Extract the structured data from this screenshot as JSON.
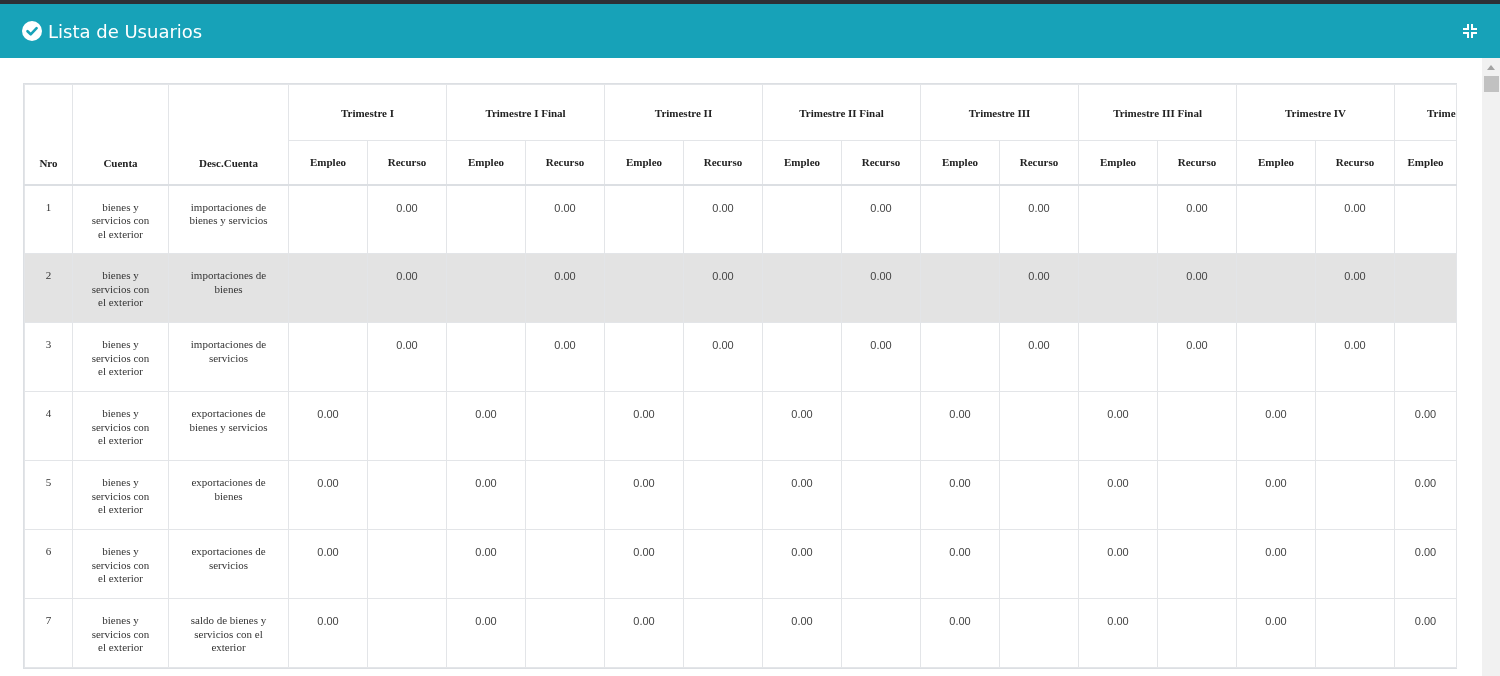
{
  "window": {
    "title": "Lista de Usuarios"
  },
  "table": {
    "columns": [
      {
        "label": "Nro"
      },
      {
        "label": "Cuenta"
      },
      {
        "label": "Desc.Cuenta"
      }
    ],
    "groups": [
      {
        "label": "Trimestre I",
        "subcolumns": [
          "Empleo",
          "Recurso"
        ]
      },
      {
        "label": "Trimestre I Final",
        "subcolumns": [
          "Empleo",
          "Recurso"
        ]
      },
      {
        "label": "Trimestre II",
        "subcolumns": [
          "Empleo",
          "Recurso"
        ]
      },
      {
        "label": "Trimestre II Final",
        "subcolumns": [
          "Empleo",
          "Recurso"
        ]
      },
      {
        "label": "Trimestre III",
        "subcolumns": [
          "Empleo",
          "Recurso"
        ]
      },
      {
        "label": "Trimestre III Final",
        "subcolumns": [
          "Empleo",
          "Recurso"
        ]
      },
      {
        "label": "Trimestre IV",
        "subcolumns": [
          "Empleo",
          "Recurso"
        ]
      },
      {
        "label": "Trime",
        "subcolumns": [
          "Empleo"
        ]
      }
    ],
    "rows": [
      {
        "nro": "1",
        "cuenta": "bienes y servicios con el exterior",
        "desc": "importaciones de bienes y servicios",
        "selected": false,
        "quarters": [
          {
            "recurso": "0.00"
          },
          {
            "recurso": "0.00"
          },
          {
            "recurso": "0.00"
          },
          {
            "recurso": "0.00"
          },
          {
            "recurso": "0.00"
          },
          {
            "recurso": "0.00"
          },
          {
            "recurso": "0.00"
          }
        ]
      },
      {
        "nro": "2",
        "cuenta": "bienes y servicios con el exterior",
        "desc": "importaciones de bienes",
        "selected": true,
        "quarters": [
          {
            "recurso": "0.00"
          },
          {
            "recurso": "0.00"
          },
          {
            "recurso": "0.00"
          },
          {
            "recurso": "0.00"
          },
          {
            "recurso": "0.00"
          },
          {
            "recurso": "0.00"
          },
          {
            "recurso": "0.00"
          }
        ]
      },
      {
        "nro": "3",
        "cuenta": "bienes y servicios con el exterior",
        "desc": "importaciones de servicios",
        "selected": false,
        "quarters": [
          {
            "recurso": "0.00"
          },
          {
            "recurso": "0.00"
          },
          {
            "recurso": "0.00"
          },
          {
            "recurso": "0.00"
          },
          {
            "recurso": "0.00"
          },
          {
            "recurso": "0.00"
          },
          {
            "recurso": "0.00"
          }
        ]
      },
      {
        "nro": "4",
        "cuenta": "bienes y servicios con el exterior",
        "desc": "exportaciones de bienes y servicios",
        "selected": false,
        "quarters": [
          {
            "empleo": "0.00"
          },
          {
            "empleo": "0.00"
          },
          {
            "empleo": "0.00"
          },
          {
            "empleo": "0.00"
          },
          {
            "empleo": "0.00"
          },
          {
            "empleo": "0.00"
          },
          {
            "empleo": "0.00"
          },
          {
            "empleo": "0.00"
          }
        ]
      },
      {
        "nro": "5",
        "cuenta": "bienes y servicios con el exterior",
        "desc": "exportaciones de bienes",
        "selected": false,
        "quarters": [
          {
            "empleo": "0.00"
          },
          {
            "empleo": "0.00"
          },
          {
            "empleo": "0.00"
          },
          {
            "empleo": "0.00"
          },
          {
            "empleo": "0.00"
          },
          {
            "empleo": "0.00"
          },
          {
            "empleo": "0.00"
          },
          {
            "empleo": "0.00"
          }
        ]
      },
      {
        "nro": "6",
        "cuenta": "bienes y servicios con el exterior",
        "desc": "exportaciones de servicios",
        "selected": false,
        "quarters": [
          {
            "empleo": "0.00"
          },
          {
            "empleo": "0.00"
          },
          {
            "empleo": "0.00"
          },
          {
            "empleo": "0.00"
          },
          {
            "empleo": "0.00"
          },
          {
            "empleo": "0.00"
          },
          {
            "empleo": "0.00"
          },
          {
            "empleo": "0.00"
          }
        ]
      },
      {
        "nro": "7",
        "cuenta": "bienes y servicios con el exterior",
        "desc": "saldo de bienes y servicios con el exterior",
        "selected": false,
        "quarters": [
          {
            "empleo": "0.00"
          },
          {
            "empleo": "0.00"
          },
          {
            "empleo": "0.00"
          },
          {
            "empleo": "0.00"
          },
          {
            "empleo": "0.00"
          },
          {
            "empleo": "0.00"
          },
          {
            "empleo": "0.00"
          },
          {
            "empleo": "0.00"
          }
        ]
      }
    ]
  }
}
